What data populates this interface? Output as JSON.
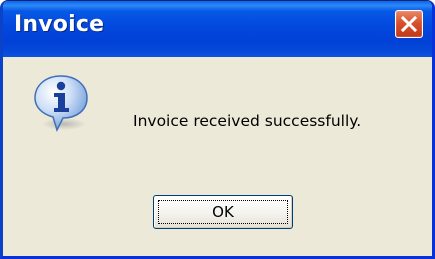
{
  "dialog": {
    "title": "Invoice",
    "message": "Invoice received successfully.",
    "ok_label": "OK",
    "icon": "info-icon"
  },
  "colors": {
    "titlebar": "#0348de",
    "body": "#ece9d8",
    "close_button": "#d8522a",
    "button_border": "#003c74"
  }
}
